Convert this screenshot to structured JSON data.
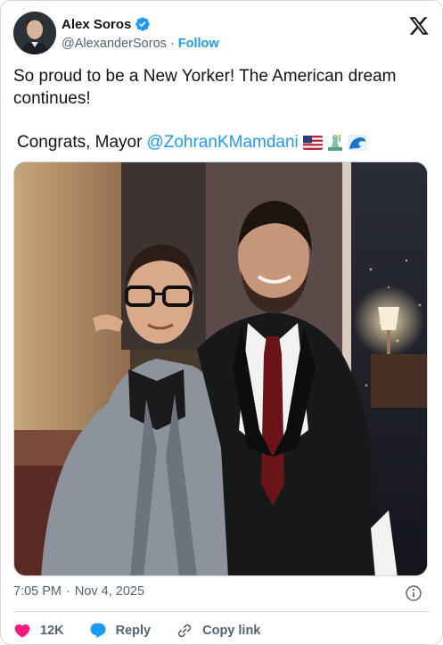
{
  "user": {
    "display_name": "Alex Soros",
    "handle": "@AlexanderSoros",
    "separator": "·",
    "follow_label": "Follow",
    "verified": true
  },
  "tweet": {
    "text": "So proud to be a New Yorker! The American dream continues!",
    "line2_prefix": "Congrats, Mayor",
    "mention": "@ZohranKMamdani",
    "emojis": [
      "us-flag-emoji",
      "statue-of-liberty-emoji",
      "wave-emoji"
    ]
  },
  "meta": {
    "time": "7:05 PM",
    "separator": "·",
    "date": "Nov 4, 2025"
  },
  "actions": {
    "likes": "12K",
    "reply_label": "Reply",
    "copy_link_label": "Copy link"
  },
  "colors": {
    "accent": "#1d9bf0",
    "like": "#f91880",
    "text": "#0f1419",
    "muted": "#536471"
  }
}
